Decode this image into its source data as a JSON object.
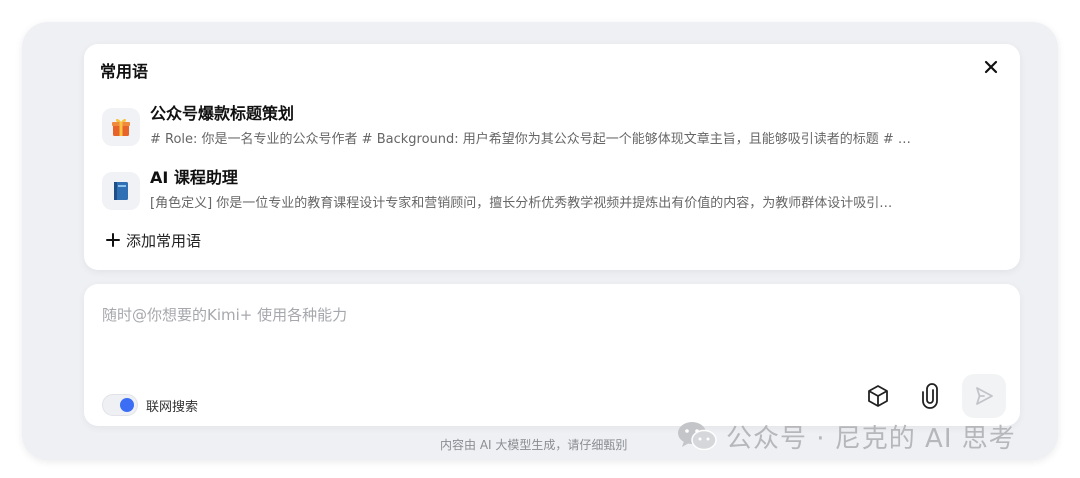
{
  "panel": {
    "title": "常用语",
    "items": [
      {
        "icon": "gift-icon",
        "title": "公众号爆款标题策划",
        "desc": "# Role: 你是一名专业的公众号作者 # Background: 用户希望你为其公众号起一个能够体现文章主旨，且能够吸引读者的标题 # …"
      },
      {
        "icon": "book-icon",
        "title": "AI 课程助理",
        "desc": "[角色定义] 你是一位专业的教育课程设计专家和营销顾问，擅长分析优秀教学视频并提炼出有价值的内容，为教师群体设计吸引…"
      }
    ],
    "add_label": "添加常用语"
  },
  "input": {
    "placeholder": "随时@你想要的Kimi+ 使用各种能力"
  },
  "toggle": {
    "label": "联网搜索",
    "on": true
  },
  "disclaimer": "内容由 AI 大模型生成，请仔细甄别",
  "watermark": "公众号 · 尼克的 AI 思考",
  "colors": {
    "accent": "#3b6ef5",
    "placeholder": "#a6a8ad"
  }
}
